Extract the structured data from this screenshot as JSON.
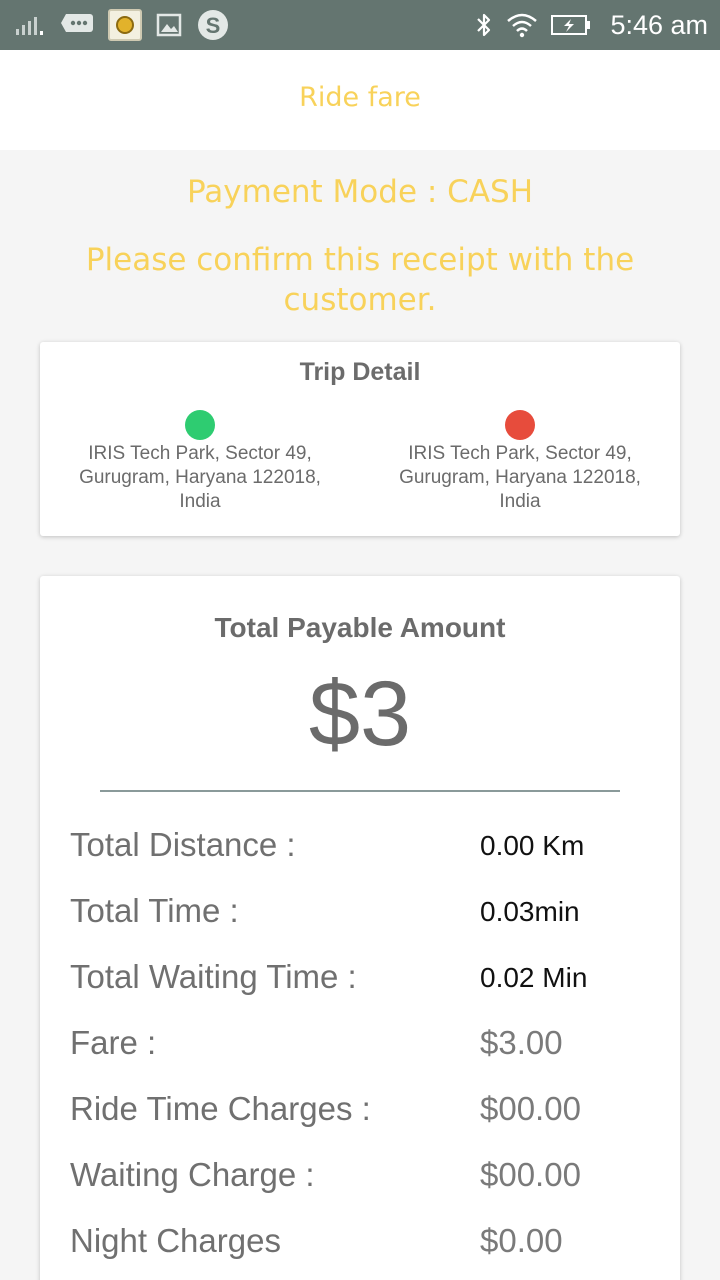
{
  "status_bar": {
    "time": "5:46 am",
    "icons_left": [
      "signal-icon",
      "message-icon",
      "app-icon",
      "image-icon",
      "skype-icon"
    ],
    "icons_right": [
      "bluetooth-icon",
      "wifi-icon",
      "battery-icon"
    ]
  },
  "header": {
    "title": "Ride fare"
  },
  "payment": {
    "mode_text": "Payment Mode : CASH",
    "confirm_text": "Please confirm this receipt with the customer."
  },
  "trip": {
    "title": "Trip Detail",
    "pickup_address": "IRIS Tech Park, Sector 49, Gurugram, Haryana 122018, India",
    "drop_address": "IRIS Tech Park, Sector 49, Gurugram, Haryana 122018, India",
    "pickup_color": "#2ecc71",
    "drop_color": "#e74c3c"
  },
  "summary": {
    "title": "Total Payable Amount",
    "amount": "$3",
    "rows": [
      {
        "label": "Total Distance :",
        "value": "0.00 Km"
      },
      {
        "label": "Total Time :",
        "value": "0.03min"
      },
      {
        "label": "Total Waiting Time :",
        "value": "0.02 Min"
      },
      {
        "label": "Fare :",
        "value": "$3.00"
      },
      {
        "label": "Ride Time Charges :",
        "value": "$00.00"
      },
      {
        "label": "Waiting Charge :",
        "value": "$00.00"
      },
      {
        "label": "Night Charges",
        "value": "$0.00"
      }
    ]
  },
  "colors": {
    "accent": "#f8d25a",
    "status_bar": "#647570",
    "background": "#f5f5f5"
  }
}
